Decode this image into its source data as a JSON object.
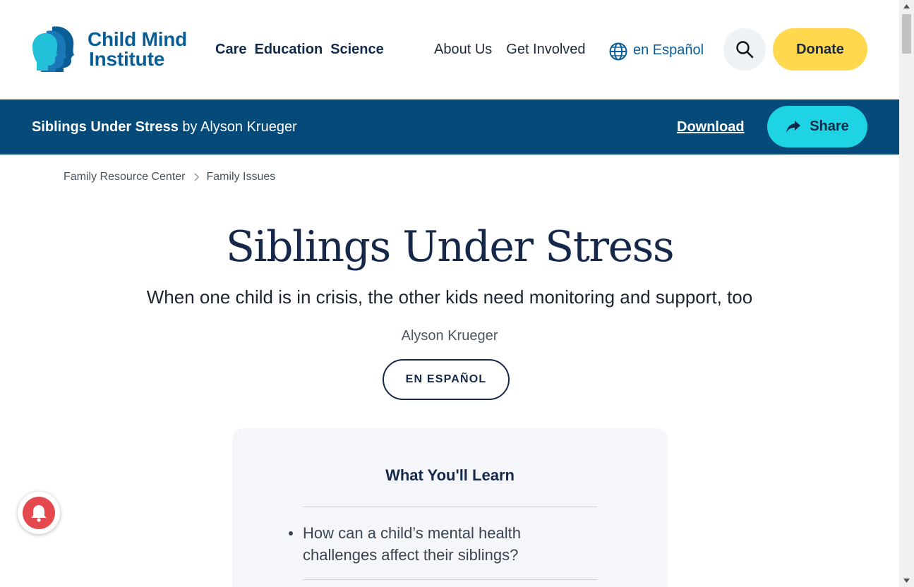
{
  "brand": {
    "name_line1": "Child Mind",
    "name_line2": "Institute",
    "colors": {
      "primary": "#0a5e95",
      "accent": "#1ed3e4",
      "donate": "#ffd84d",
      "bar": "#064a79"
    }
  },
  "nav": {
    "primary": [
      "Care",
      "Education",
      "Science"
    ],
    "secondary": [
      "About Us",
      "Get Involved"
    ],
    "language_label": "en Español",
    "search_icon": "search-icon",
    "donate_label": "Donate"
  },
  "article_bar": {
    "title": "Siblings Under Stress",
    "byline": "by Alyson Krueger",
    "download_label": "Download",
    "share_label": "Share"
  },
  "breadcrumb": [
    "Family Resource Center",
    "Family Issues"
  ],
  "article": {
    "title": "Siblings Under Stress",
    "subtitle": "When one child is in crisis, the other kids need monitoring and support, too",
    "author": "Alyson Krueger",
    "spanish_button": "EN ESPAÑOL"
  },
  "learn": {
    "heading": "What You'll Learn",
    "items": [
      "How can a child’s mental health challenges affect their siblings?"
    ]
  },
  "widgets": {
    "notification_icon": "bell-icon"
  }
}
